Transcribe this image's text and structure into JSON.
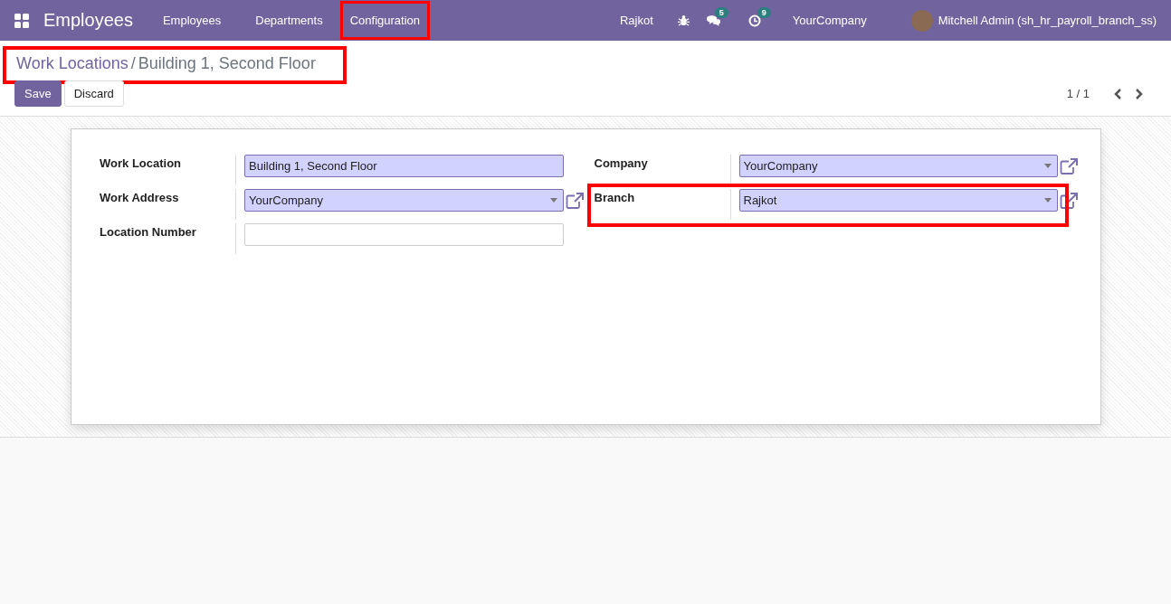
{
  "navbar": {
    "app_name": "Employees",
    "menu": [
      {
        "label": "Employees",
        "highlighted": false
      },
      {
        "label": "Departments",
        "highlighted": false
      },
      {
        "label": "Configuration",
        "highlighted": true
      }
    ],
    "branch": "Rajkot",
    "messages_count": "5",
    "activities_count": "9",
    "company": "YourCompany",
    "user": "Mitchell Admin (sh_hr_payroll_branch_ss)"
  },
  "breadcrumb": {
    "parent": "Work Locations",
    "separator": "/",
    "current": "Building 1, Second Floor",
    "highlighted": true
  },
  "buttons": {
    "save": "Save",
    "discard": "Discard"
  },
  "pager": {
    "value": "1 / 1"
  },
  "form": {
    "left": [
      {
        "label": "Work Location",
        "kind": "text",
        "value": "Building 1, Second Floor",
        "required": true,
        "highlighted": false
      },
      {
        "label": "Work Address",
        "kind": "many2one",
        "value": "YourCompany",
        "required": true,
        "highlighted": false
      },
      {
        "label": "Location Number",
        "kind": "text",
        "required": false,
        "highlighted": false
      }
    ],
    "right": [
      {
        "label": "Company",
        "kind": "many2one",
        "value": "YourCompany",
        "required": true,
        "highlighted": false
      },
      {
        "label": "Branch",
        "kind": "many2one",
        "value": "Rajkot",
        "required": true,
        "highlighted": true
      }
    ]
  }
}
